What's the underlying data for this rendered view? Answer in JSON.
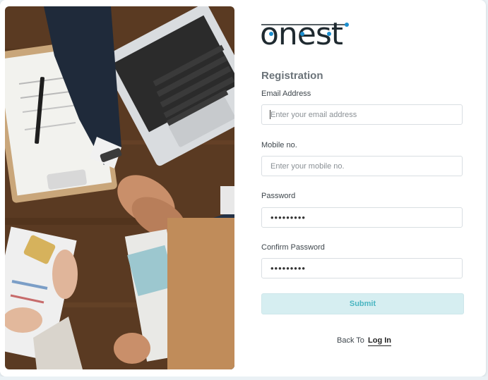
{
  "brand": {
    "logo_text": "onest",
    "accent_color": "#1b8ecf",
    "text_color": "#1f2a30"
  },
  "form": {
    "title": "Registration",
    "email": {
      "label": "Email Address",
      "placeholder": "Enter your email address",
      "value": ""
    },
    "mobile": {
      "label": "Mobile no.",
      "placeholder": "Enter your mobile no.",
      "value": ""
    },
    "password": {
      "label": "Password",
      "value": "•••••••••"
    },
    "confirm": {
      "label": "Confirm Password",
      "value": "•••••••••"
    },
    "submit_label": "Submit"
  },
  "footer": {
    "back_text": "Back To",
    "login_link": "Log In"
  },
  "colors": {
    "submit_bg": "#d6eef1",
    "submit_text": "#49b5c1"
  }
}
